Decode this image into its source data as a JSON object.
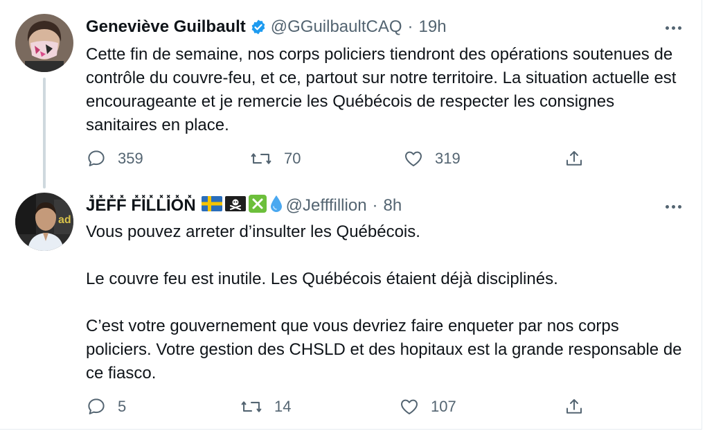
{
  "tweet1": {
    "name": "Geneviève Guilbault",
    "handle": "@GGuilbaultCAQ",
    "separator": "·",
    "time": "19h",
    "text": "Cette fin de semaine, nos corps policiers tiendront des opérations soutenues de contrôle du couvre-feu, et ce, partout sur notre territoire. La situation actuelle est encourageante et je remercie les Québécois de respecter les consignes sanitaires en place.",
    "replies": "359",
    "retweets": "70",
    "likes": "319"
  },
  "tweet2": {
    "name": "J̽E̽F̽F̽ F̽I̽L̽L̽I̽O̽N̽",
    "flag_icons": [
      "sweden-flag-icon",
      "pirate-flag-icon",
      "cross-mark-icon",
      "droplet-icon"
    ],
    "handle": "@Jefffillion",
    "separator": "·",
    "time": "8h",
    "text": "Vous pouvez arreter d’insulter les Québécois.\n\nLe couvre feu est inutile. Les Québécois étaient déjà disciplinés.\n\nC’est votre gouvernement que vous devriez faire enqueter par nos corps policiers. Votre gestion des CHSLD et des hopitaux est la grande responsable de ce fiasco.",
    "replies": "5",
    "retweets": "14",
    "likes": "107"
  },
  "colors": {
    "text": "#0f1419",
    "secondary": "#536471",
    "verified": "#1d9bf0",
    "thread_line": "#cfd9de"
  }
}
